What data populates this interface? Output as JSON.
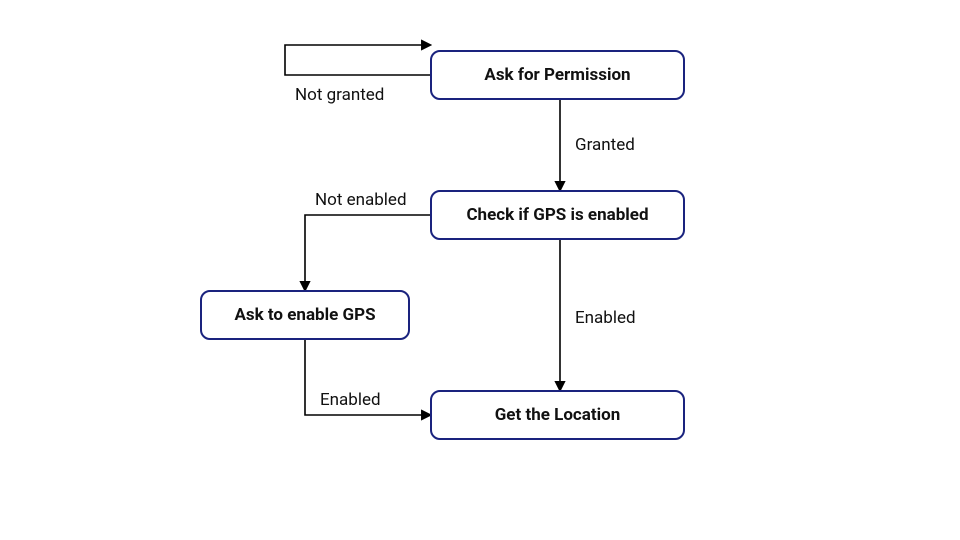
{
  "diagram": {
    "type": "flowchart",
    "nodes": {
      "ask_permission": {
        "label": "Ask for Permission"
      },
      "check_gps": {
        "label": "Check if GPS is enabled"
      },
      "ask_enable_gps": {
        "label": "Ask to enable GPS"
      },
      "get_location": {
        "label": "Get the Location"
      }
    },
    "edges": {
      "perm_not_granted": {
        "label": "Not granted",
        "from": "ask_permission",
        "to": "ask_permission"
      },
      "perm_granted": {
        "label": "Granted",
        "from": "ask_permission",
        "to": "check_gps"
      },
      "gps_not_enabled": {
        "label": "Not enabled",
        "from": "check_gps",
        "to": "ask_enable_gps"
      },
      "gps_enabled": {
        "label": "Enabled",
        "from": "check_gps",
        "to": "get_location"
      },
      "gps_after_enable": {
        "label": "Enabled",
        "from": "ask_enable_gps",
        "to": "get_location"
      }
    },
    "colors": {
      "border": "#1a237e",
      "stroke": "#000000"
    }
  }
}
